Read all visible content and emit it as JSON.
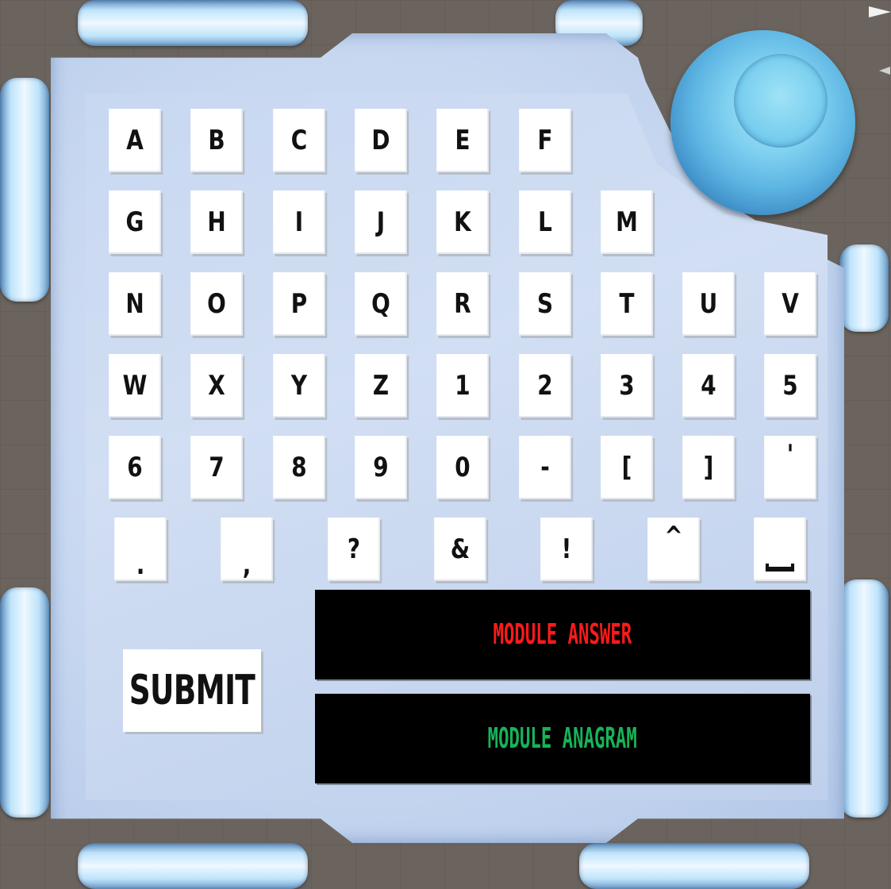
{
  "keyboard": {
    "rows": [
      [
        "A",
        "B",
        "C",
        "D",
        "E",
        "F"
      ],
      [
        "G",
        "H",
        "I",
        "J",
        "K",
        "L",
        "M"
      ],
      [
        "N",
        "O",
        "P",
        "Q",
        "R",
        "S",
        "T",
        "U",
        "V"
      ],
      [
        "W",
        "X",
        "Y",
        "Z",
        "1",
        "2",
        "3",
        "4",
        "5"
      ],
      [
        "6",
        "7",
        "8",
        "9",
        "0",
        "-",
        "[",
        "]",
        "'"
      ],
      [
        ".",
        ",",
        "?",
        "&",
        "!",
        "^",
        "space"
      ]
    ]
  },
  "submit": {
    "label": "SUBMIT"
  },
  "displays": {
    "answer": {
      "text": "MODULE ANSWER",
      "color": "#ff1a1a"
    },
    "anagram": {
      "text": "MODULE ANAGRAM",
      "color": "#17b35a"
    }
  },
  "colors": {
    "panel": "#c9d9f2",
    "frame": "#bfe4fb",
    "key_face": "#ffffff",
    "screen": "#000000",
    "background": "#6b645e"
  }
}
